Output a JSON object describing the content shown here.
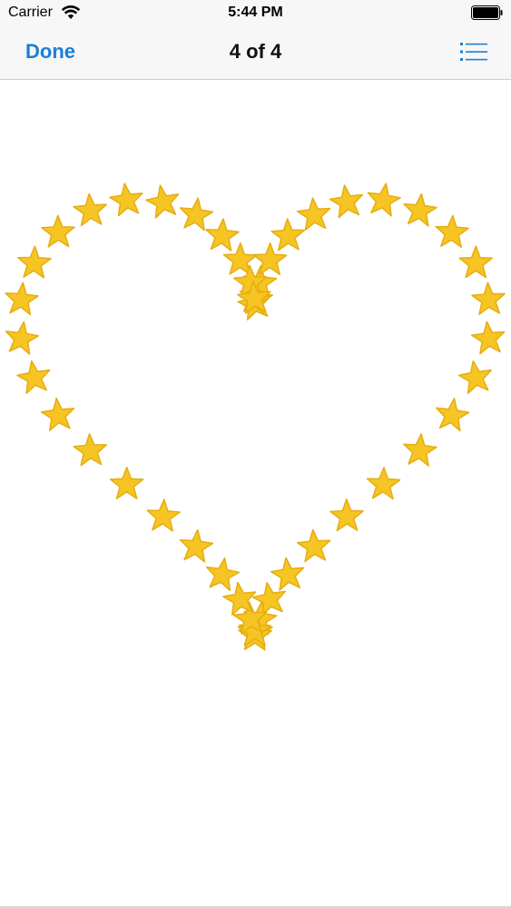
{
  "status_bar": {
    "carrier": "Carrier",
    "time": "5:44 PM"
  },
  "nav": {
    "done_label": "Done",
    "title": "4 of 4"
  },
  "icons": {
    "wifi": "wifi-icon",
    "battery": "battery-icon",
    "list": "list-icon",
    "star": "star-icon"
  },
  "colors": {
    "accent": "#1a7fd4",
    "star_fill": "#f6c523",
    "star_edge": "#e6ad10",
    "bar_bg": "#f7f7f8"
  },
  "image": {
    "subject": "heart-of-stars",
    "star_count": 46
  }
}
